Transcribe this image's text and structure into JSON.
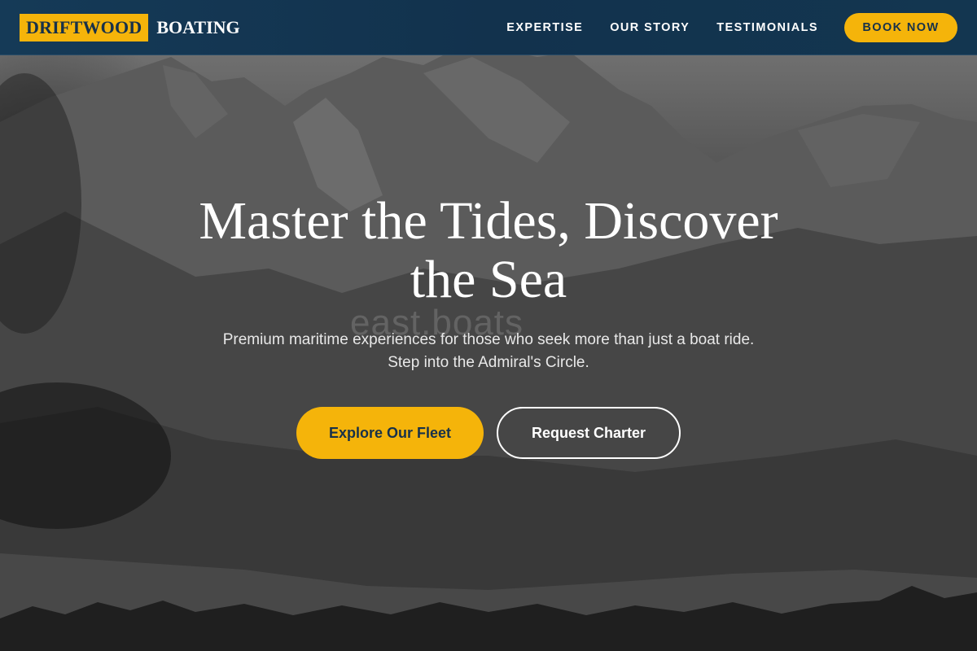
{
  "header": {
    "logo_mark": "DRIFTWOOD",
    "logo_text": "BOATING",
    "nav": [
      {
        "label": "EXPERTISE"
      },
      {
        "label": "OUR STORY"
      },
      {
        "label": "TESTIMONIALS"
      }
    ],
    "book_label": "BOOK NOW"
  },
  "hero": {
    "headline_line1": "Master the Tides, Discover",
    "headline_line2": "the Sea",
    "watermark": "east.boats",
    "subtitle": "Premium maritime experiences for those who seek more than just a boat ride. Step into the Admiral's Circle.",
    "primary_cta": "Explore Our Fleet",
    "secondary_cta": "Request Charter"
  },
  "colors": {
    "accent": "#f5b40a",
    "header_bg": "#12324d",
    "text_dark": "#17314a"
  }
}
